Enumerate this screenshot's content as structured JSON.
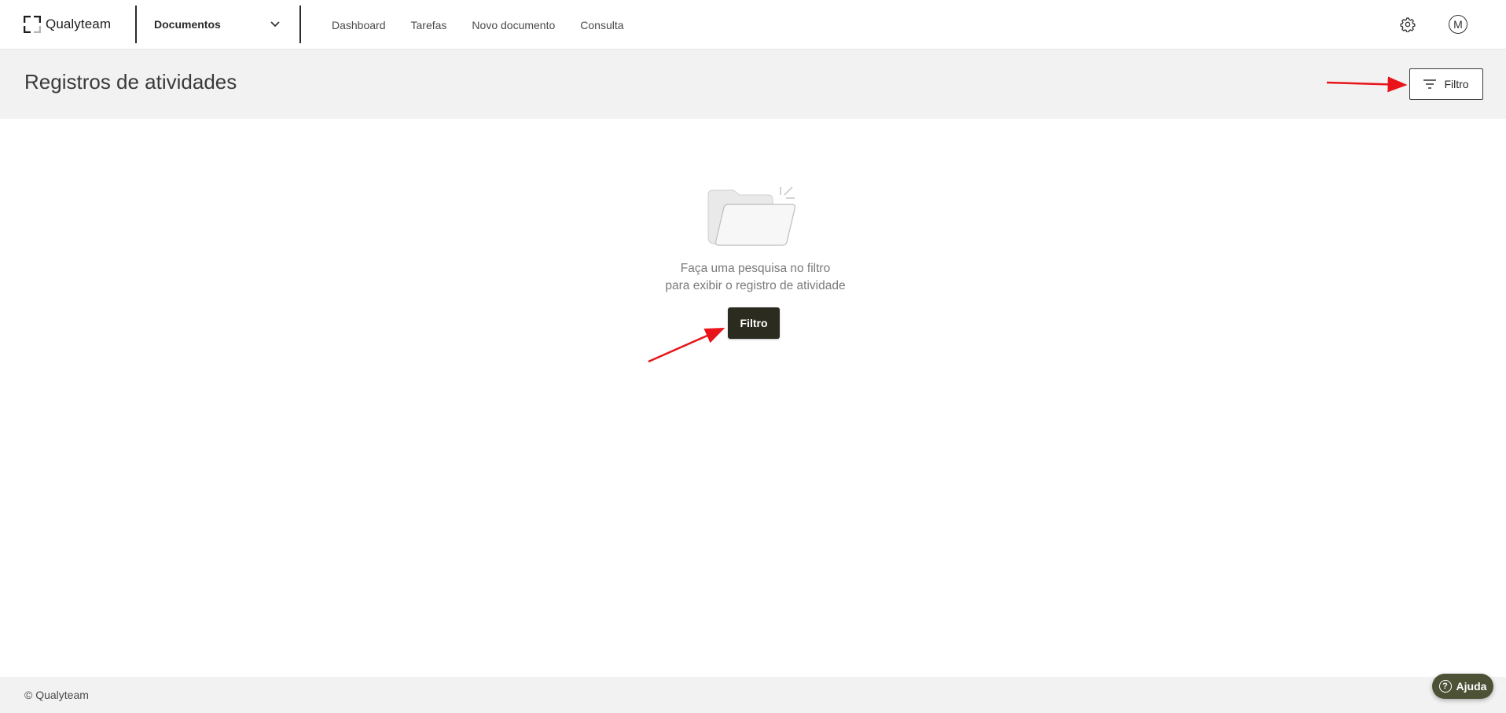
{
  "topbar": {
    "brand": "Qualyteam",
    "module": "Documentos",
    "nav": [
      "Dashboard",
      "Tarefas",
      "Novo documento",
      "Consulta"
    ],
    "avatar_initial": "M"
  },
  "header": {
    "title": "Registros de atividades",
    "filter_label": "Filtro"
  },
  "empty_state": {
    "line1": "Faça uma pesquisa no filtro",
    "line2": "para exibir o registro de atividade",
    "button_label": "Filtro"
  },
  "footer": {
    "copyright": "© Qualyteam",
    "help_label": "Ajuda"
  },
  "colors": {
    "primary_dark": "#2b2b1f",
    "help_bg": "#4d5236",
    "annotation": "#e8141a",
    "band_bg": "#f2f2f2"
  }
}
